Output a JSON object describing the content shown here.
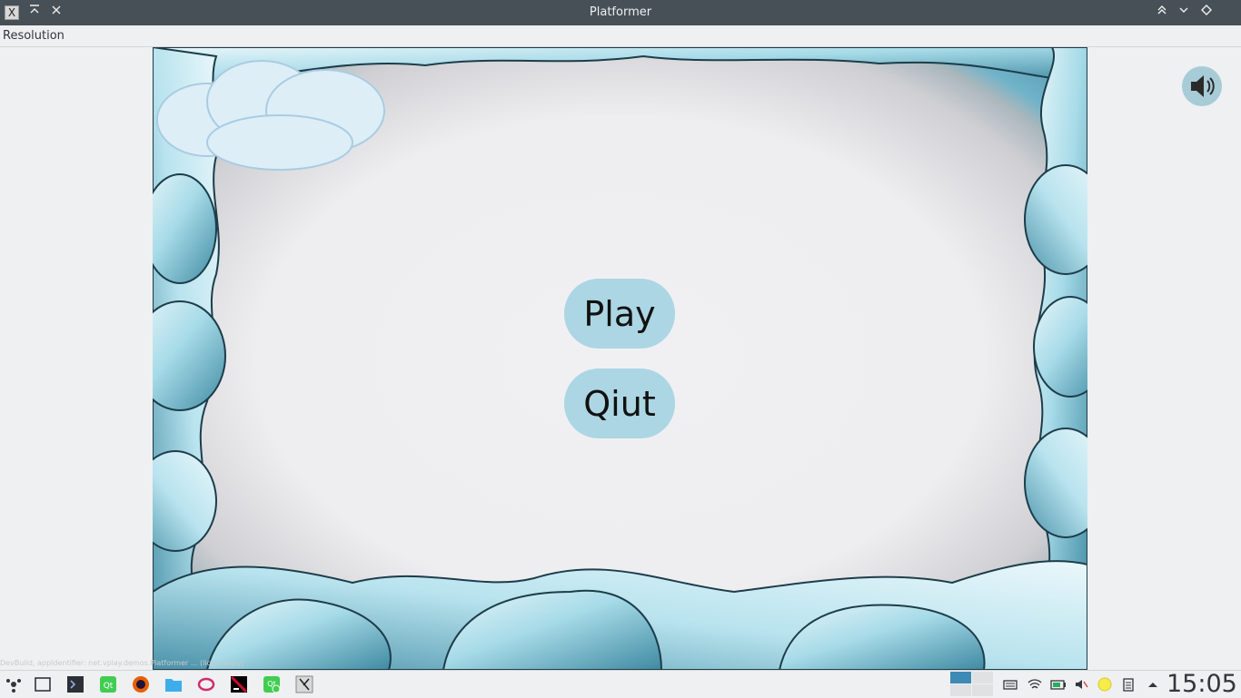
{
  "window": {
    "title": "Platformer",
    "app_icon": "X",
    "controls_left": [
      "keep-above-icon",
      "close-icon"
    ],
    "controls_right": [
      "minimize-icon",
      "restore-icon",
      "maximize-icon"
    ]
  },
  "menubar": {
    "items": [
      "Resolution"
    ]
  },
  "game": {
    "play_label": "Play",
    "quit_label": "Qiut",
    "sound_icon": "speaker-icon",
    "accent": "#acd6e3"
  },
  "devbuild_text": "DevBuild, appIdentifier: net.vplay.demos.Platformer ... (licenseKey)",
  "taskbar": {
    "launcher_icon": "application-launcher-icon",
    "tasks": [
      "show-desktop-icon",
      "terminal-icon",
      "qt-creator-icon",
      "firefox-icon",
      "file-manager-icon",
      "chromium-icon",
      "jetbrains-icon",
      "qt-maintenance-icon",
      "platformer-app-icon"
    ],
    "tray": [
      "keyboard-icon",
      "wifi-icon",
      "battery-icon",
      "volume-icon",
      "night-light-icon",
      "clipboard-icon",
      "expand-tray-icon"
    ],
    "clock": "15:05"
  }
}
